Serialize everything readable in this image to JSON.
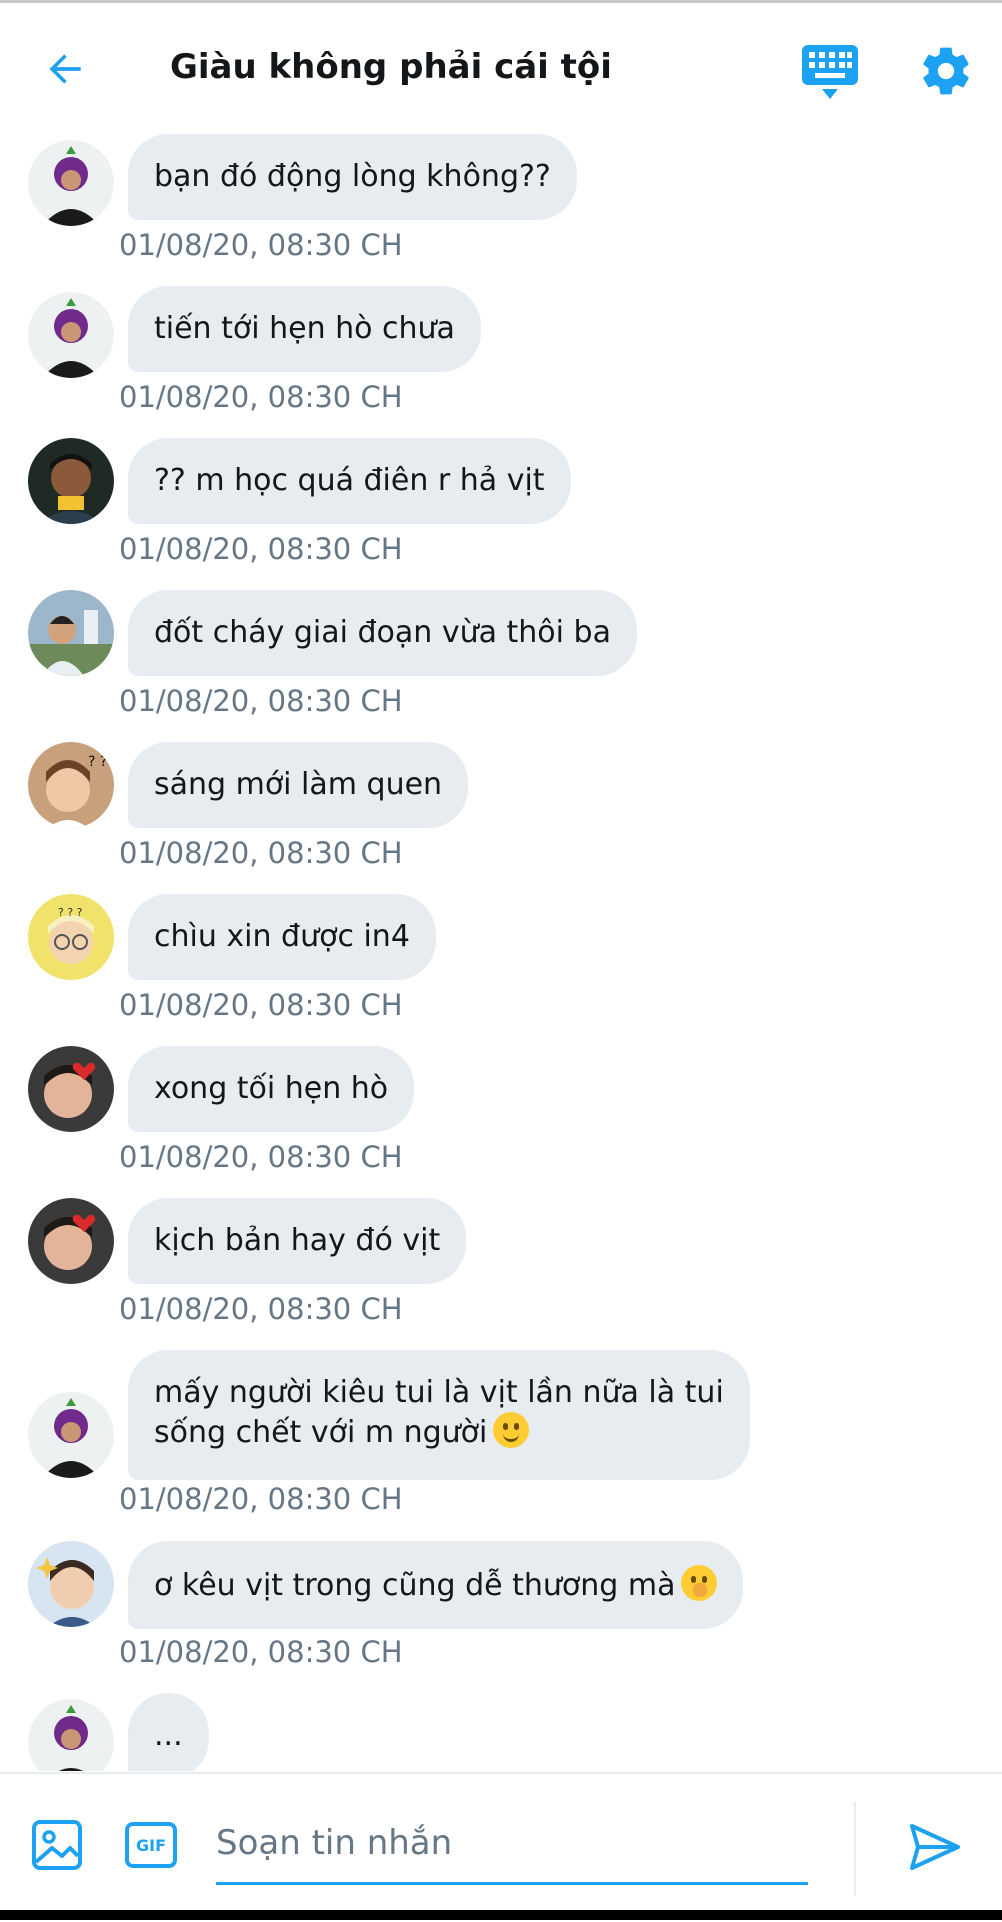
{
  "header": {
    "title": "Giàu không phải cái tội",
    "back_icon": "arrow-left-icon",
    "keyboard_icon": "keyboard-icon",
    "settings_icon": "gear-icon"
  },
  "colors": {
    "accent": "#1da1f2",
    "bubble": "#e6ecf0",
    "timestamp": "#657786"
  },
  "messages": [
    {
      "text": "bạn đó động lòng không??",
      "time": "01/08/20, 08:30 CH",
      "avatar": "purple-hair-avatar"
    },
    {
      "text": "tiến tới hẹn hò chưa",
      "time": "01/08/20, 08:30 CH",
      "avatar": "purple-hair-avatar"
    },
    {
      "text": "?? m học quá điên r hả vịt",
      "time": "01/08/20, 08:30 CH",
      "avatar": "dark-photo-avatar"
    },
    {
      "text": "đốt cháy giai đoạn vừa thôi ba",
      "time": "01/08/20, 08:30 CH",
      "avatar": "outdoor-photo-avatar"
    },
    {
      "text": "sáng mới làm quen",
      "time": "01/08/20, 08:30 CH",
      "avatar": "question-marks-avatar"
    },
    {
      "text": "chìu xin được in4",
      "time": "01/08/20, 08:30 CH",
      "avatar": "yellow-glasses-avatar"
    },
    {
      "text": "xong tối hẹn hò",
      "time": "01/08/20, 08:30 CH",
      "avatar": "heart-avatar"
    },
    {
      "text": "kịch bản hay đó vịt",
      "time": "01/08/20, 08:30 CH",
      "avatar": "heart-avatar"
    },
    {
      "line1": "mấy người kiêu tui là vịt lần nữa là tui",
      "line2": "sống chết với m người",
      "emoji": "slightly-smiling-emoji",
      "time": "01/08/20, 08:30 CH",
      "avatar": "purple-hair-avatar"
    },
    {
      "text": "ơ kêu vịt trong cũng dễ thương mà",
      "emoji": "hand-over-mouth-emoji",
      "time": "01/08/20, 08:30 CH",
      "avatar": "sparkle-avatar"
    },
    {
      "text": "...",
      "avatar": "purple-hair-avatar"
    }
  ],
  "composer": {
    "placeholder": "Soạn tin nhắn",
    "image_icon": "image-icon",
    "gif_icon": "gif-icon",
    "gif_label": "GIF",
    "send_icon": "send-icon"
  }
}
